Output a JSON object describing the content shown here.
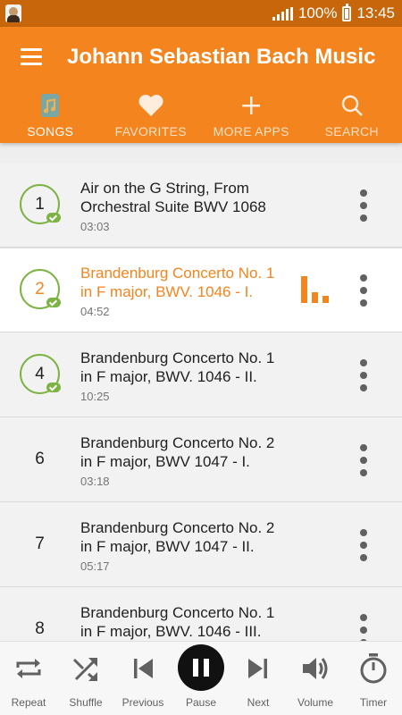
{
  "status_bar": {
    "battery": "100%",
    "time": "13:45"
  },
  "app_bar": {
    "title": "Johann Sebastian Bach Music"
  },
  "tabs": [
    {
      "label": "SONGS",
      "icon": "music-file-icon",
      "active": true
    },
    {
      "label": "FAVORITES",
      "icon": "heart-icon",
      "active": false
    },
    {
      "label": "MORE APPS",
      "icon": "plus-icon",
      "active": false
    },
    {
      "label": "SEARCH",
      "icon": "search-icon",
      "active": false
    }
  ],
  "songs": [
    {
      "number": "1",
      "title": "Air on the G String, From Orchestral Suite BWV 1068",
      "duration": "03:03",
      "downloaded": true,
      "playing": false
    },
    {
      "number": "2",
      "title": "Brandenburg Concerto No. 1 in F major, BWV. 1046 - I.",
      "duration": "04:52",
      "downloaded": true,
      "playing": true
    },
    {
      "number": "4",
      "title": "Brandenburg Concerto No. 1 in F major, BWV. 1046 - II.",
      "duration": "10:25",
      "downloaded": true,
      "playing": false
    },
    {
      "number": "6",
      "title": "Brandenburg Concerto No. 2 in F major, BWV 1047 - I.",
      "duration": "03:18",
      "downloaded": false,
      "playing": false
    },
    {
      "number": "7",
      "title": "Brandenburg Concerto No. 2 in F major, BWV 1047 - II.",
      "duration": "05:17",
      "downloaded": false,
      "playing": false
    },
    {
      "number": "8",
      "title": "Brandenburg Concerto No. 1 in F major, BWV. 1046 - III.",
      "duration": "",
      "downloaded": false,
      "playing": false
    }
  ],
  "player": {
    "controls": [
      {
        "label": "Repeat",
        "icon": "repeat-icon"
      },
      {
        "label": "Shuffle",
        "icon": "shuffle-icon"
      },
      {
        "label": "Previous",
        "icon": "skip-previous-icon"
      },
      {
        "label": "Pause",
        "icon": "pause-icon"
      },
      {
        "label": "Next",
        "icon": "skip-next-icon"
      },
      {
        "label": "Volume",
        "icon": "volume-icon"
      },
      {
        "label": "Timer",
        "icon": "timer-icon"
      }
    ]
  },
  "colors": {
    "accent": "#f4841d",
    "status_bar": "#c8660b",
    "downloaded": "#7cb342"
  }
}
